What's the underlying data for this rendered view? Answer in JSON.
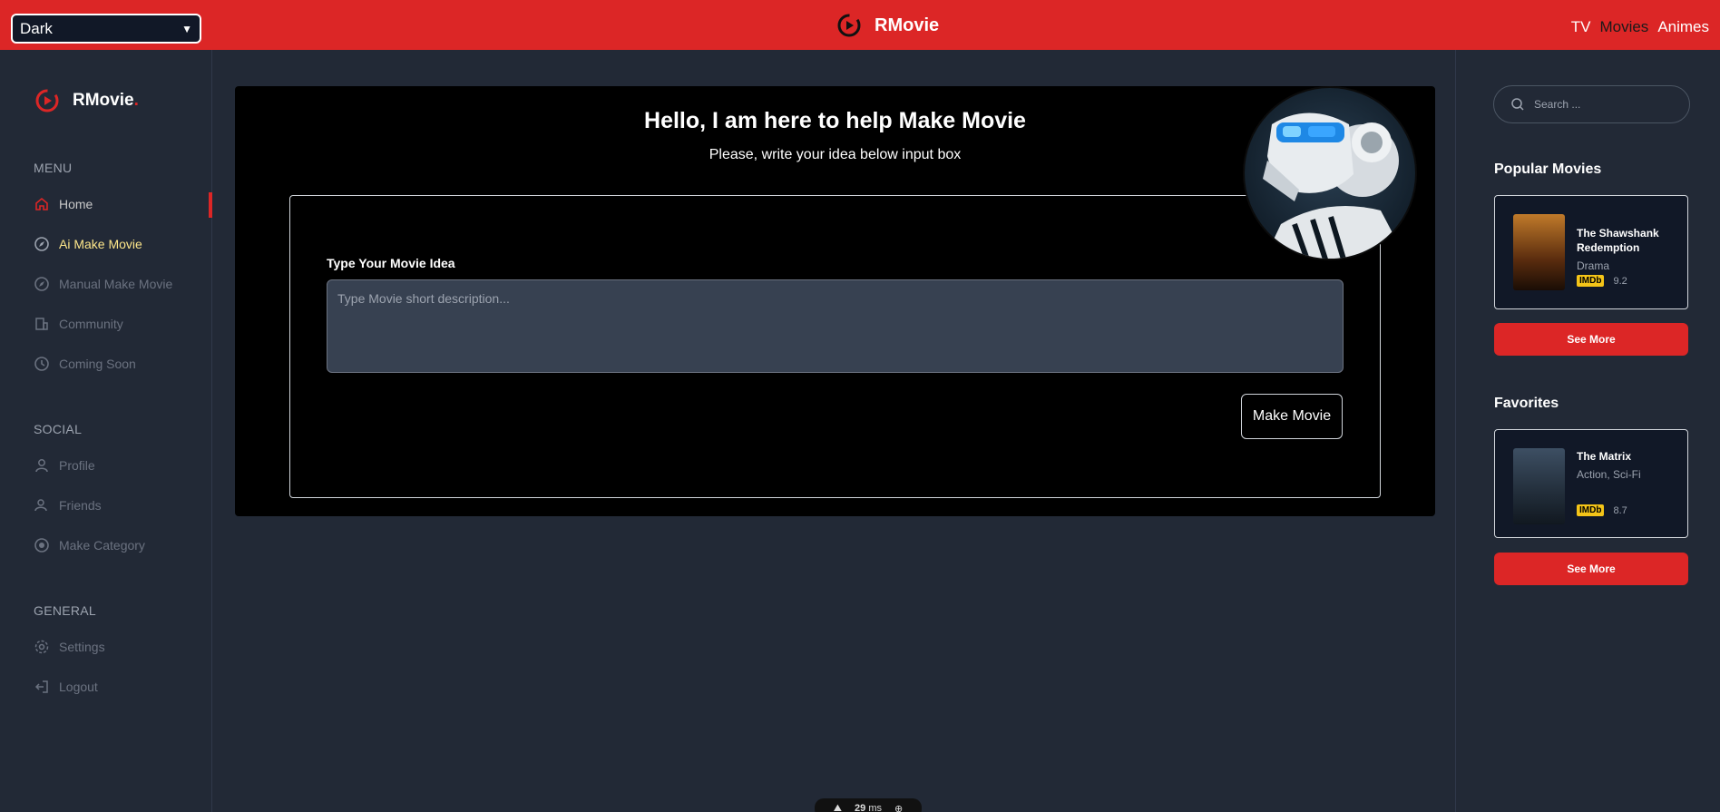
{
  "topbar": {
    "theme_value": "Dark",
    "brand": "RMovie",
    "nav": [
      "TV",
      "Movies",
      "Animes"
    ]
  },
  "sidebar": {
    "brand": "RMovie",
    "brand_dot": ".",
    "menu_title": "MENU",
    "menu": [
      {
        "label": "Home",
        "icon": "home-icon"
      },
      {
        "label": "Ai Make Movie",
        "icon": "compass-icon"
      },
      {
        "label": "Manual Make Movie",
        "icon": "compass-icon"
      },
      {
        "label": "Community",
        "icon": "building-icon"
      },
      {
        "label": "Coming Soon",
        "icon": "clock-icon"
      }
    ],
    "social_title": "SOCIAL",
    "social": [
      {
        "label": "Profile",
        "icon": "user-icon"
      },
      {
        "label": "Friends",
        "icon": "users-icon"
      },
      {
        "label": "Make Category",
        "icon": "target-icon"
      }
    ],
    "general_title": "GENERAL",
    "general": [
      {
        "label": "Settings",
        "icon": "gear-icon"
      },
      {
        "label": "Logout",
        "icon": "logout-icon"
      }
    ]
  },
  "main": {
    "heading": "Hello, I am here to help Make Movie",
    "subheading": "Please, write your idea below input box",
    "label": "Type Your Movie Idea",
    "placeholder": "Type Movie short description...",
    "button": "Make Movie"
  },
  "right": {
    "search_placeholder": "Search ...",
    "popular_title": "Popular Movies",
    "popular": {
      "title": "The Shawshank Redemption",
      "genre": "Drama",
      "imdb": "IMDb",
      "rating": "9.2"
    },
    "favorites_title": "Favorites",
    "favorite": {
      "title": "The Matrix",
      "genre": "Action, Sci-Fi",
      "imdb": "IMDb",
      "rating": "8.7"
    },
    "see_more": "See More"
  },
  "fps": {
    "value": "29",
    "unit": "ms"
  },
  "colors": {
    "accent": "#dc2626",
    "active": "#fde68a",
    "bg": "#222936"
  }
}
